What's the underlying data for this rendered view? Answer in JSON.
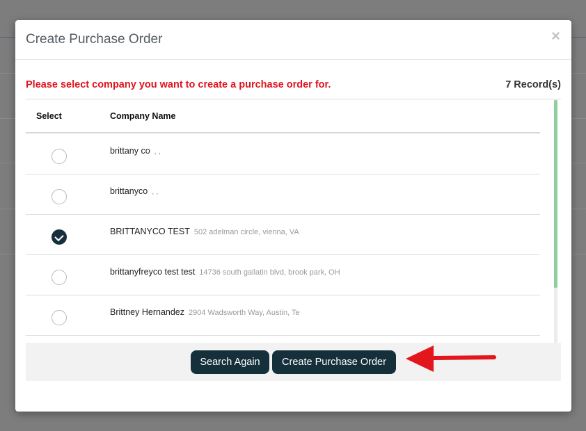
{
  "modal": {
    "title": "Create Purchase Order",
    "close_glyph": "×"
  },
  "notice": "Please select company you want to create a purchase order for.",
  "record_count": "7 Record(s)",
  "table": {
    "headers": {
      "select": "Select",
      "company_name": "Company Name"
    },
    "rows": [
      {
        "company": "brittany co",
        "address": ", ,",
        "selected": false
      },
      {
        "company": "brittanyco",
        "address": ", ,",
        "selected": false
      },
      {
        "company": "BRITTANYCO TEST",
        "address": "502 adelman circle, vienna, VA",
        "selected": true
      },
      {
        "company": "brittanyfreyco test test",
        "address": "14736 south gallatin blvd, brook park, OH",
        "selected": false
      },
      {
        "company": "Brittney Hernandez",
        "address": "2904 Wadsworth Way, Austin, Te",
        "selected": false
      }
    ]
  },
  "buttons": {
    "search_again": "Search Again",
    "create_purchase_order": "Create Purchase Order"
  },
  "colors": {
    "primary_button": "#15303b",
    "notice_red": "#e0141e",
    "arrow_red": "#e3161b",
    "scroll_thumb": "#8fcf9e"
  },
  "icons": {
    "close": "close-icon",
    "check": "checkmark-icon",
    "annotation": "arrow-left-icon"
  }
}
